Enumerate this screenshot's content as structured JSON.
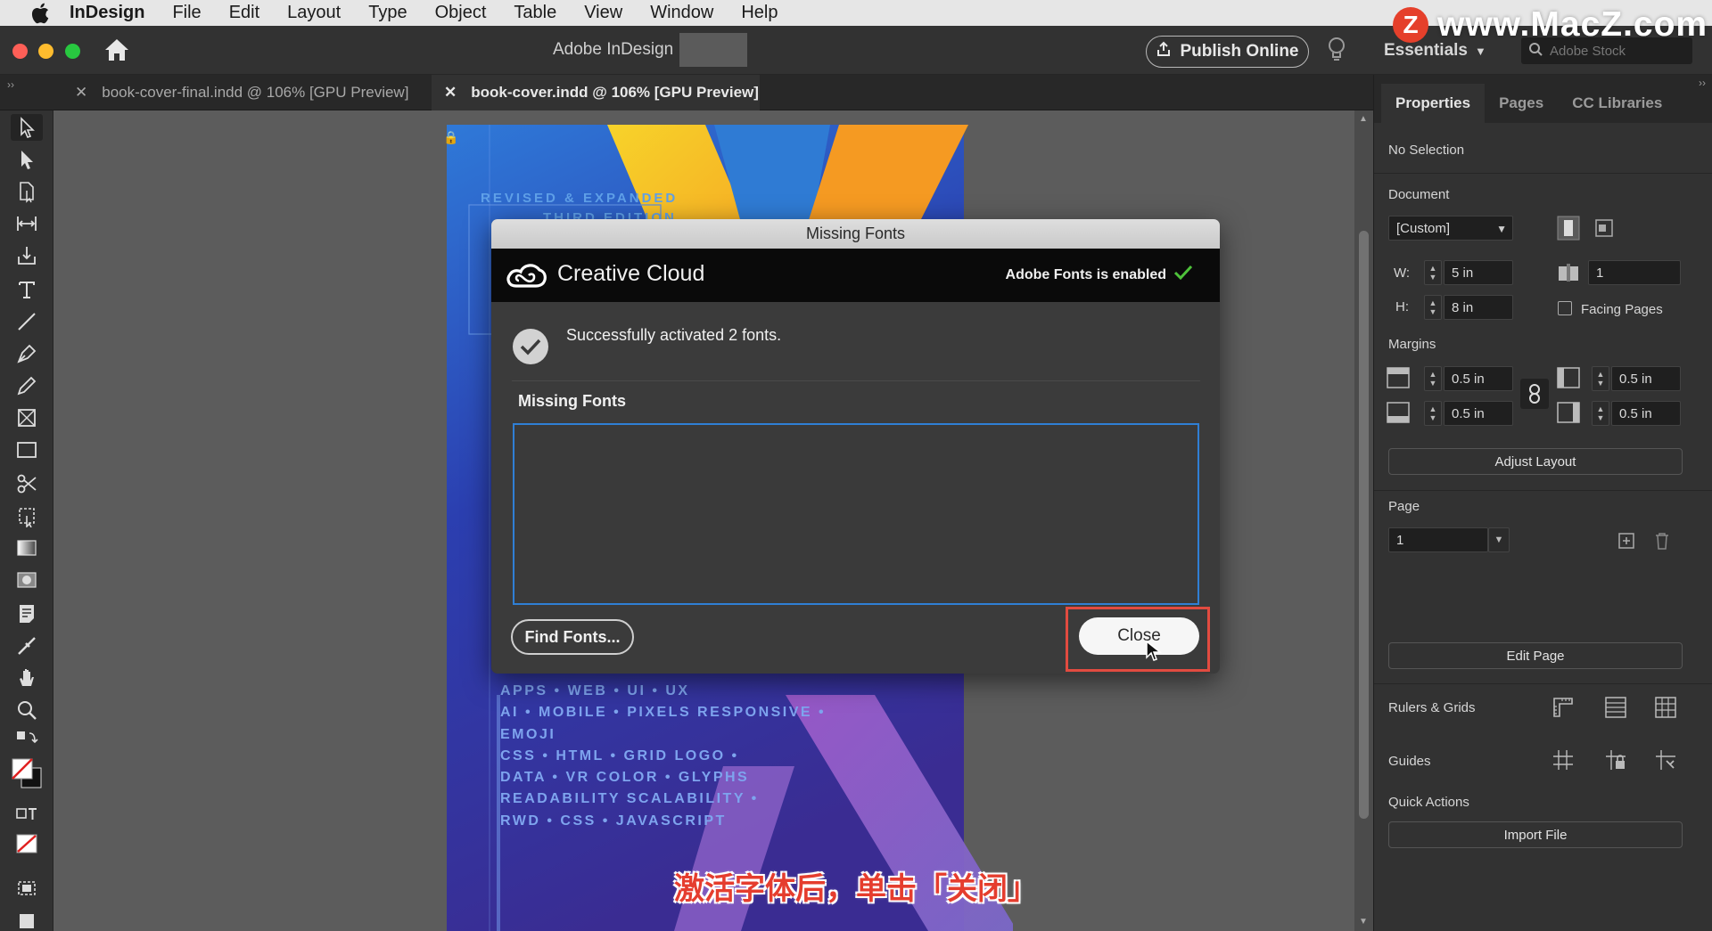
{
  "menubar": {
    "app_name": "InDesign",
    "items": [
      "File",
      "Edit",
      "Layout",
      "Type",
      "Object",
      "Table",
      "View",
      "Window",
      "Help"
    ]
  },
  "watermark": {
    "logo_letter": "Z",
    "text": "www.MacZ.com"
  },
  "appbar": {
    "title": "Adobe InDesign",
    "publish_label": "Publish Online",
    "workspace": "Essentials",
    "stock_placeholder": "Adobe Stock"
  },
  "tabs": [
    {
      "label": "book-cover-final.indd @ 106% [GPU Preview]",
      "active": false
    },
    {
      "label": "book-cover.indd @ 106% [GPU Preview]",
      "active": true
    }
  ],
  "cover": {
    "top_text_1": "REVISED & EXPANDED",
    "top_text_2": "THIRD EDITION",
    "tags": [
      "APPS • WEB • UI • UX",
      "AI • MOBILE • PIXELS RESPONSIVE •",
      "EMOJI",
      "CSS • HTML • GRID LOGO •",
      "DATA • VR COLOR • GLYPHS",
      "READABILITY SCALABILITY •",
      "RWD • CSS • JAVASCRIPT"
    ]
  },
  "panel": {
    "tabs": [
      "Properties",
      "Pages",
      "CC Libraries"
    ],
    "selection": "No Selection",
    "document": {
      "heading": "Document",
      "preset": "[Custom]",
      "w_label": "W:",
      "w_value": "5 in",
      "h_label": "H:",
      "h_value": "8 in",
      "pages_value": "1",
      "facing_pages_label": "Facing Pages",
      "facing_pages": false
    },
    "margins": {
      "heading": "Margins",
      "top": "0.5 in",
      "bottom": "0.5 in",
      "left": "0.5 in",
      "right": "0.5 in"
    },
    "adjust_layout": "Adjust Layout",
    "page": {
      "heading": "Page",
      "value": "1",
      "edit_label": "Edit Page"
    },
    "rulers_grids": "Rulers & Grids",
    "guides": "Guides",
    "quick_actions": {
      "heading": "Quick Actions",
      "import_label": "Import File"
    }
  },
  "dialog": {
    "title": "Missing Fonts",
    "brand": "Creative Cloud",
    "fonts_status": "Adobe Fonts is enabled",
    "success": "Successfully activated 2 fonts.",
    "list_label": "Missing Fonts",
    "find_label": "Find Fonts...",
    "close_label": "Close"
  },
  "subtitle": "激活字体后，单击「关闭」",
  "colors": {
    "accent_blue": "#2f7fd5",
    "highlight_red": "#e24b40",
    "check_green": "#4ec23a"
  }
}
